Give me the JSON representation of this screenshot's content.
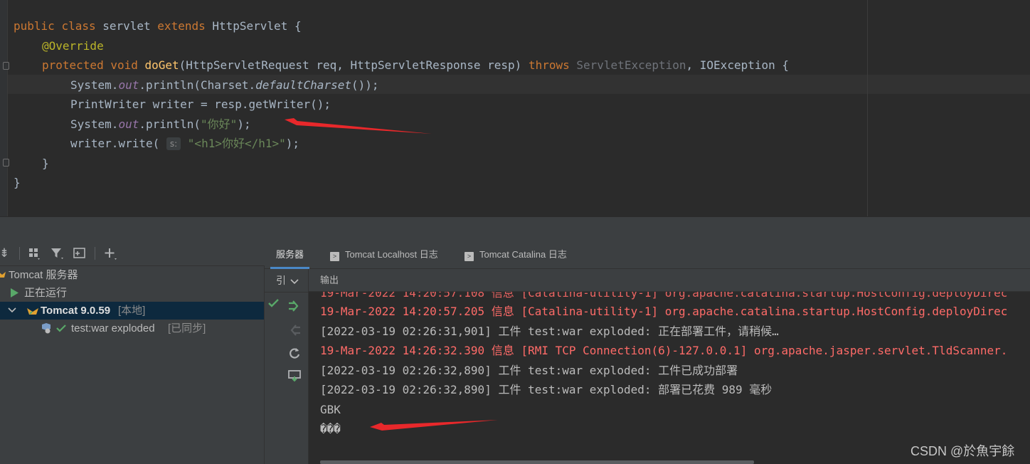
{
  "editor": {
    "lines": [
      {
        "parts": [
          {
            "t": "public ",
            "c": "kw"
          },
          {
            "t": "class ",
            "c": "kw"
          },
          {
            "t": "servlet ",
            "c": ""
          },
          {
            "t": "extends ",
            "c": "kw"
          },
          {
            "t": "HttpServlet {",
            "c": ""
          }
        ]
      },
      {
        "indent": 4,
        "parts": [
          {
            "t": "@Override",
            "c": "ann"
          }
        ]
      },
      {
        "indent": 4,
        "parts": [
          {
            "t": "protected ",
            "c": "kw"
          },
          {
            "t": "void ",
            "c": "kw"
          },
          {
            "t": "doGet",
            "c": "fn"
          },
          {
            "t": "(HttpServletRequest req, HttpServletResponse resp) ",
            "c": ""
          },
          {
            "t": "throws ",
            "c": "kw"
          },
          {
            "t": "ServletException",
            "c": "dim"
          },
          {
            "t": ", IOException {",
            "c": ""
          }
        ]
      },
      {
        "indent": 8,
        "parts": [
          {
            "t": "System.",
            "c": ""
          },
          {
            "t": "out",
            "c": "fld"
          },
          {
            "t": ".println(Charset.",
            "c": ""
          },
          {
            "t": "defaultCharset",
            "c": "it"
          },
          {
            "t": "());",
            "c": ""
          }
        ]
      },
      {
        "indent": 8,
        "parts": [
          {
            "t": "PrintWriter writer = resp.getWriter();",
            "c": ""
          }
        ]
      },
      {
        "indent": 8,
        "parts": [
          {
            "t": "System.",
            "c": ""
          },
          {
            "t": "out",
            "c": "fld"
          },
          {
            "t": ".println(",
            "c": ""
          },
          {
            "t": "\"你好\"",
            "c": "str"
          },
          {
            "t": ");",
            "c": ""
          }
        ]
      },
      {
        "indent": 8,
        "parts": [
          {
            "t": "writer.write( ",
            "c": ""
          },
          {
            "t": "s:",
            "c": "hint"
          },
          {
            "t": " ",
            "c": ""
          },
          {
            "t": "\"<h1>你好</h1>\"",
            "c": "str"
          },
          {
            "t": ");",
            "c": ""
          }
        ]
      },
      {
        "indent": 4,
        "parts": [
          {
            "t": "}",
            "c": ""
          }
        ]
      },
      {
        "parts": [
          {
            "t": "}",
            "c": ""
          }
        ]
      }
    ]
  },
  "services": {
    "tree": {
      "root_label": "Tomcat 服务器",
      "status_label": "正在运行",
      "server_label": "Tomcat 9.0.59",
      "server_suffix": "[本地]",
      "artifact_label": "test:war exploded",
      "artifact_suffix": "[已同步]"
    },
    "tabs": [
      {
        "label": "服务器"
      },
      {
        "label": "Tomcat Localhost 日志"
      },
      {
        "label": "Tomcat Catalina 日志"
      }
    ],
    "strip_top_label": "引",
    "output_header": "输出",
    "output_lines": [
      {
        "text": "19-Mar-2022 14:20:57.205 信息 [Catalina-utility-1] org.apache.catalina.startup.HostConfig.deployDirec",
        "err": true
      },
      {
        "text": "[2022-03-19 02:26:31,901] 工件 test:war exploded: 正在部署工件，请稍候…",
        "err": false
      },
      {
        "text": "19-Mar-2022 14:26:32.390 信息 [RMI TCP Connection(6)-127.0.0.1] org.apache.jasper.servlet.TldScanner.",
        "err": true
      },
      {
        "text": "[2022-03-19 02:26:32,890] 工件 test:war exploded: 工件已成功部署",
        "err": false
      },
      {
        "text": "[2022-03-19 02:26:32,890] 工件 test:war exploded: 部署已花费 989 毫秒",
        "err": false
      },
      {
        "text": "GBK",
        "err": false
      },
      {
        "text": "���",
        "err": false
      }
    ]
  },
  "watermark": "CSDN @於魚宇餘",
  "colors": {
    "accent": "#4a88c7",
    "error": "#ff6b68",
    "annotation_arrow": "#e8282b"
  }
}
